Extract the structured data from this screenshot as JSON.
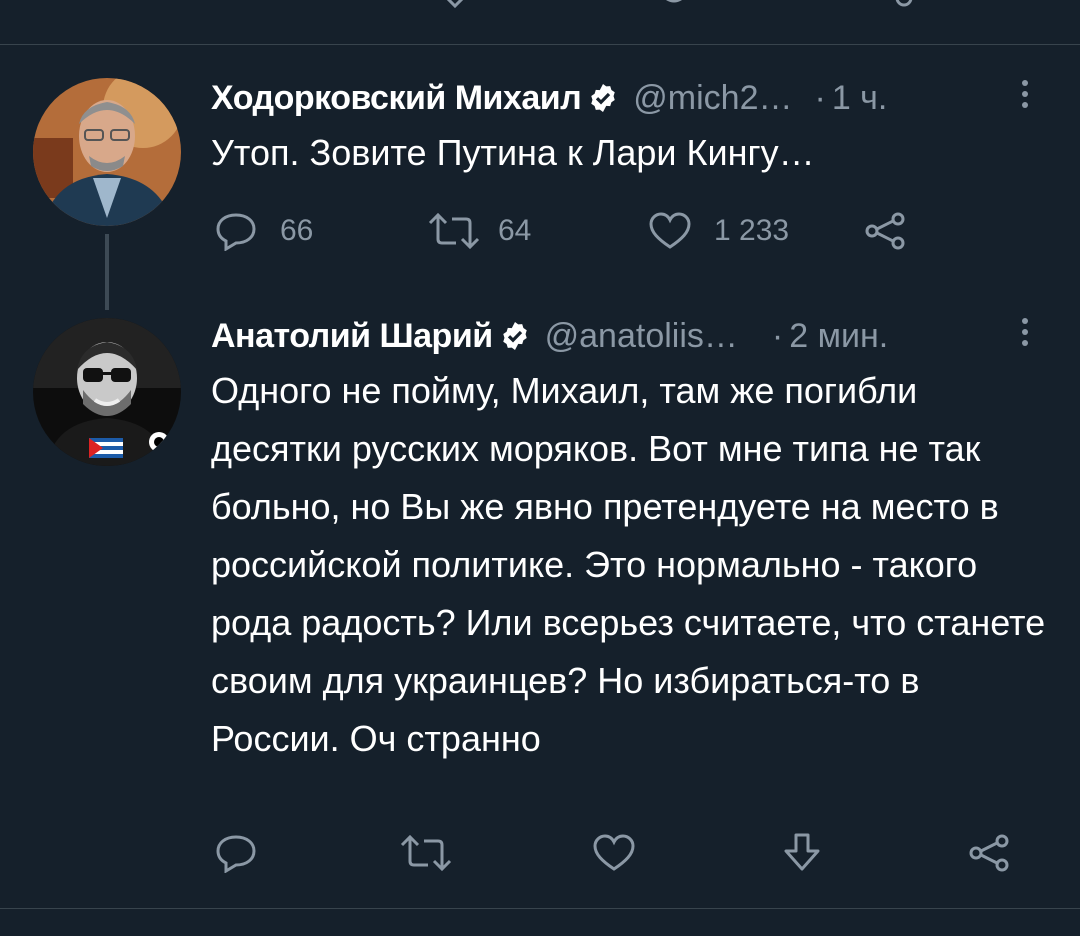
{
  "tweets": [
    {
      "author_name": "Ходорковский Михаил",
      "handle": "@mich2…",
      "time_separator": "·",
      "time": "1 ч.",
      "text": "Утоп. Зовите Путина к Лари Кингу…",
      "actions": {
        "reply_count": "66",
        "retweet_count": "64",
        "like_count": "1 233"
      }
    },
    {
      "author_name": "Анатолий Шарий",
      "handle": "@anatoliis…",
      "time_separator": "·",
      "time": "2 мин.",
      "text": "Одного не пойму, Михаил, там же погибли десятки русских моряков. Вот мне типа не так больно, но Вы же явно претендуете на место в российской политике. Это нормально - такого рода радость? Или всерьез считаете, что станете своим для украинцев? Но избираться-то в России. Оч странно"
    }
  ],
  "colors": {
    "background": "#15202b",
    "divider": "#38444d",
    "secondary_text": "#8b98a5",
    "verified_badge": "#ffffff"
  },
  "icons": [
    "reply-icon",
    "retweet-icon",
    "like-icon",
    "share-icon",
    "download-icon",
    "verified-badge-icon",
    "more-options-icon"
  ]
}
